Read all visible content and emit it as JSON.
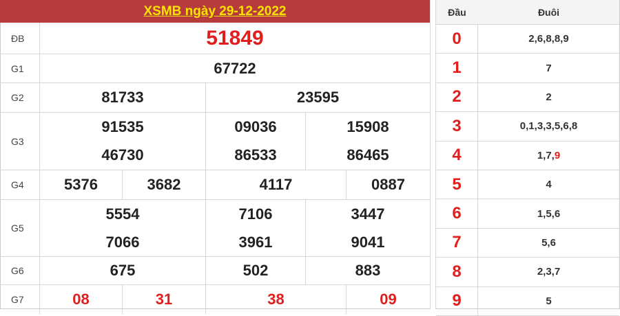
{
  "title": "XSMB ngày 29-12-2022",
  "prizes": {
    "db": {
      "label": "ĐB",
      "values": [
        "51849"
      ]
    },
    "g1": {
      "label": "G1",
      "values": [
        "67722"
      ]
    },
    "g2": {
      "label": "G2",
      "values": [
        "81733",
        "23595"
      ]
    },
    "g3": {
      "label": "G3",
      "values": [
        "91535",
        "09036",
        "15908",
        "46730",
        "86533",
        "86465"
      ]
    },
    "g4": {
      "label": "G4",
      "values": [
        "5376",
        "3682",
        "4117",
        "0887"
      ]
    },
    "g5": {
      "label": "G5",
      "values": [
        "5554",
        "7106",
        "3447",
        "7066",
        "3961",
        "9041"
      ]
    },
    "g6": {
      "label": "G6",
      "values": [
        "675",
        "502",
        "883"
      ]
    },
    "g7": {
      "label": "G7",
      "values": [
        "08",
        "31",
        "38",
        "09"
      ]
    }
  },
  "loto": {
    "head_label": "Đầu",
    "tail_label": "Đuôi",
    "rows": [
      {
        "dau": "0",
        "duoi": "2,6,8,8,9"
      },
      {
        "dau": "1",
        "duoi": "7"
      },
      {
        "dau": "2",
        "duoi": "2"
      },
      {
        "dau": "3",
        "duoi": "0,1,3,3,5,6,8"
      },
      {
        "dau": "4",
        "duoi": "1,7,",
        "duoi_highlight": "9"
      },
      {
        "dau": "5",
        "duoi": "4"
      },
      {
        "dau": "6",
        "duoi": "1,5,6"
      },
      {
        "dau": "7",
        "duoi": "5,6"
      },
      {
        "dau": "8",
        "duoi": "2,3,7"
      },
      {
        "dau": "9",
        "duoi": "5"
      }
    ]
  },
  "colors": {
    "header_bg": "#b53b3d",
    "header_text": "#ffe300",
    "accent_red": "#e01e1e"
  }
}
